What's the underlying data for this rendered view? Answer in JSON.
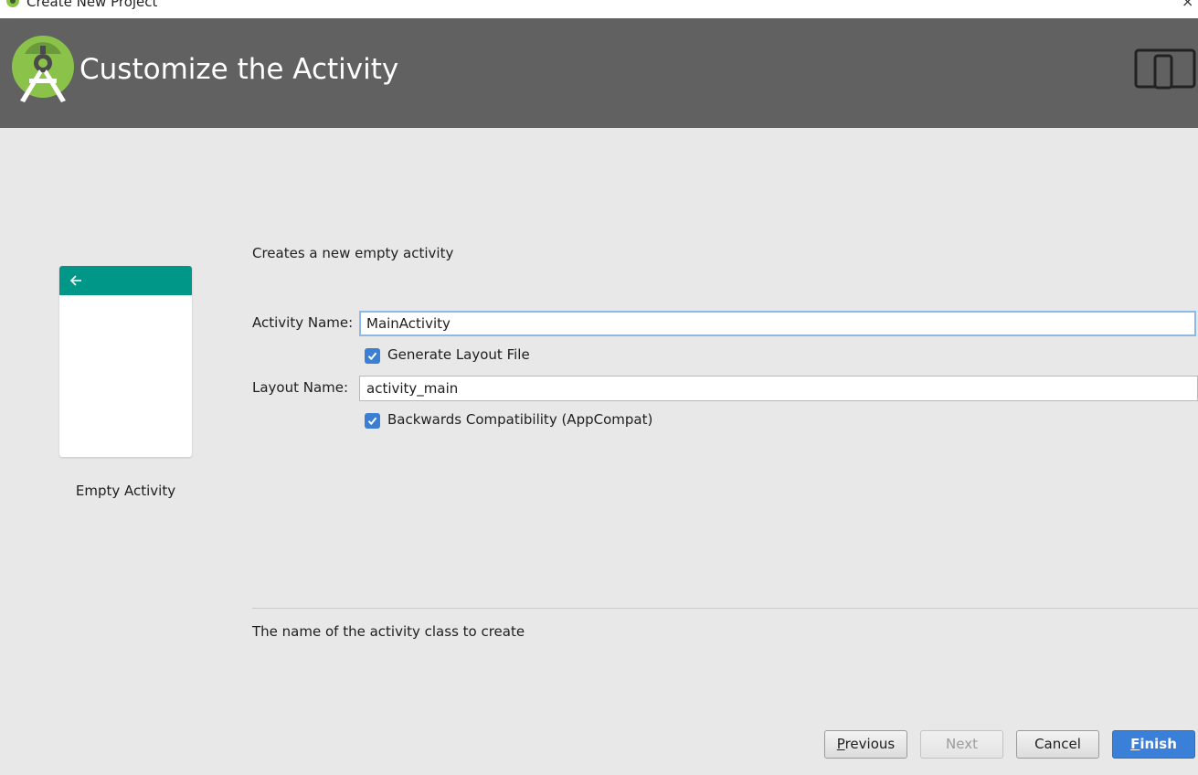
{
  "window": {
    "title": "Create New Project",
    "close_glyph": "×"
  },
  "header": {
    "title": "Customize the Activity",
    "logo_icon": "android-studio-icon",
    "device_icon": "phone-tablet-icon"
  },
  "template": {
    "name": "Empty Activity",
    "appbar_color": "#009688"
  },
  "form": {
    "description": "Creates a new empty activity",
    "activity_name_label": "Activity Name:",
    "activity_name_value": "MainActivity",
    "generate_layout_label": "Generate Layout File",
    "generate_layout_checked": true,
    "layout_name_label": "Layout Name:",
    "layout_name_value": "activity_main",
    "backwards_compat_label": "Backwards Compatibility (AppCompat)",
    "backwards_compat_checked": true
  },
  "hint": "The name of the activity class to create",
  "buttons": {
    "previous": {
      "first": "P",
      "rest": "revious"
    },
    "next": "Next",
    "cancel": "Cancel",
    "finish": {
      "first": "F",
      "rest": "inish"
    }
  },
  "colors": {
    "accent": "#3b7fd4",
    "banner": "#616161",
    "android_green": "#8bc34a"
  }
}
